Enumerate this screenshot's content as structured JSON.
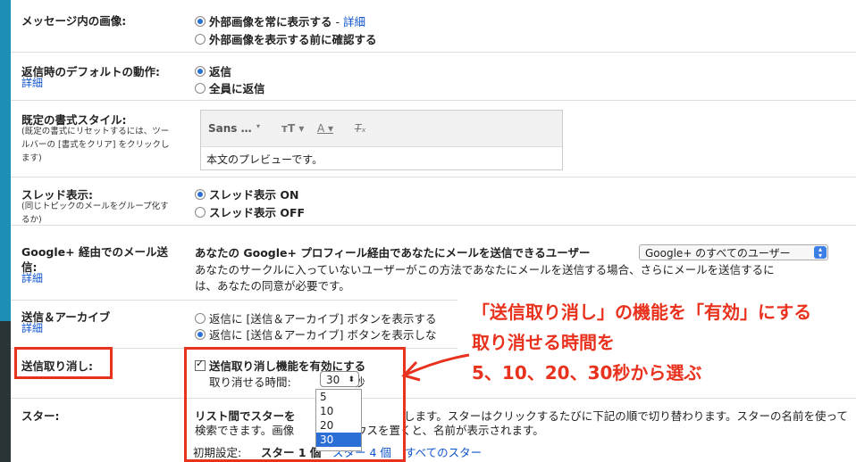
{
  "accent": "#e8321e",
  "images": {
    "label": "メッセージ内の画像:",
    "opt1": "外部画像を常に表示する",
    "dash": " - ",
    "opt1_link": "詳細",
    "opt2": "外部画像を表示する前に確認する"
  },
  "reply": {
    "label": "返信時のデフォルトの動作:",
    "link": "詳細",
    "opt1": "返信",
    "opt2": "全員に返信"
  },
  "format": {
    "label": "既定の書式スタイル:",
    "sub": "(既定の書式にリセットするには、ツールバーの [書式をクリア] をクリックします)",
    "font": "Sans …",
    "preview": "本文のプレビューです。"
  },
  "thread": {
    "label": "スレッド表示:",
    "sub": "(同じトピックのメールをグループ化するか)",
    "opt1": "スレッド表示 ON",
    "opt2": "スレッド表示 OFF"
  },
  "gplus": {
    "label1": "Google+ 経由でのメール送",
    "label2": "信:",
    "link": "詳細",
    "text1": "あなたの Google+ プロフィール経由であなたにメールを送信できるユーザー",
    "select": "Google+ のすべてのユーザー",
    "text2": "あなたのサークルに入っていないユーザーがこの方法であなたにメールを送信する場合、さらにメールを送信するに",
    "text3": "は、あなたの同意が必要です。"
  },
  "archive": {
    "label": "送信＆アーカイブ",
    "link": "詳細",
    "opt1": "返信に [送信＆アーカイブ] ボタンを表示する",
    "opt2": "返信に [送信＆アーカイブ] ボタンを表示しな"
  },
  "undo": {
    "label": "送信取り消し:",
    "check": "送信取り消し機能を有効にする",
    "time_label": "取り消せる時間:",
    "value": "30",
    "unit": "秒",
    "options": [
      "5",
      "10",
      "20",
      "30"
    ]
  },
  "stars": {
    "label": "スター:",
    "text1": "リスト間でスターを",
    "text1b": "します。スターはクリックするたびに下記の順で切り替わります。スターの名前を使って",
    "text2": "検索できます。画像",
    "text2b": "ウスを置くと、名前が表示されます。",
    "default_label": "初期設定:",
    "star1": "スター 1 個",
    "star4": "スター 4 個",
    "allstars": "すべてのスター"
  },
  "annotation": {
    "line1": "「送信取り消し」の機能を「有効」にする",
    "line2": "取り消せる時間を",
    "line3": "5、10、20、30秒から選ぶ"
  }
}
